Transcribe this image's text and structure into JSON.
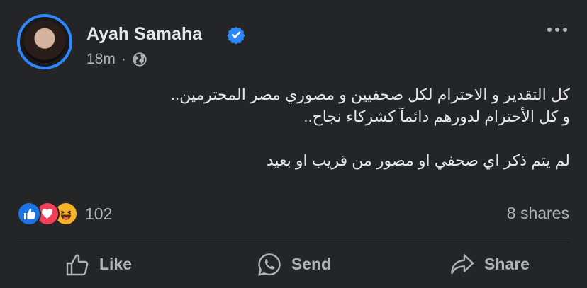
{
  "post": {
    "author": "Ayah Samaha",
    "verified": true,
    "time": "18m",
    "separator": "·",
    "audience_icon": "globe-icon",
    "text_lines": [
      "كل التقدير و الاحترام لكل صحفيين و مصوري مصر المحترمين..",
      "و كل الأحترام لدورهم دائمآ كشركاء نجاح..",
      "",
      "لم يتم ذكر اي صحفي او مصور من قريب او بعيد"
    ]
  },
  "reactions": {
    "types": [
      "like",
      "love",
      "haha"
    ],
    "count": "102",
    "shares": "8 shares"
  },
  "actions": {
    "like": "Like",
    "send": "Send",
    "share": "Share"
  },
  "colors": {
    "background": "#242526",
    "text": "#e4e6eb",
    "secondary": "#b0b3b8",
    "accent": "#2d88ff"
  }
}
